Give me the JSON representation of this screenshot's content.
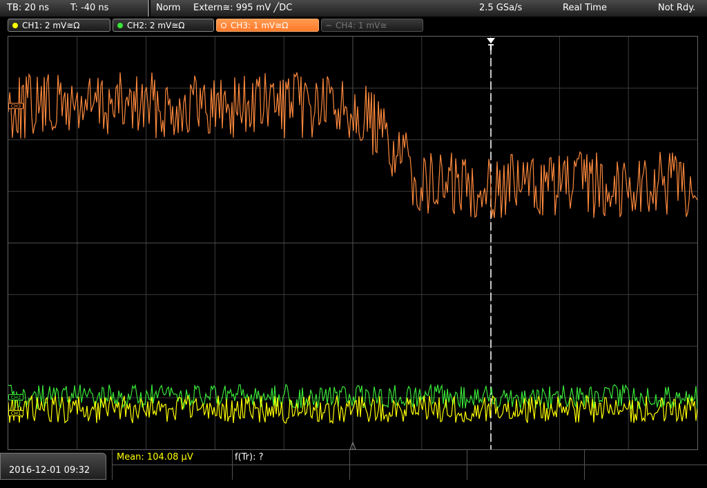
{
  "header": {
    "timebase": "TB: 20 ns",
    "trigger_time": "T: -40 ns",
    "acq_mode": "Norm",
    "trigger_source": "Extern≅: 995 mV ╱DC",
    "sample_rate": "2.5 GSa/s",
    "mode": "Real Time",
    "status": "Not Rdy."
  },
  "channels": [
    {
      "label": "CH1: 2 mV≅Ω",
      "color": "#ffff00",
      "state": "on"
    },
    {
      "label": "CH2: 2 mV≅Ω",
      "color": "#39e639",
      "state": "on"
    },
    {
      "label": "CH3: 1 mV≅Ω",
      "color": "#ff8a3d",
      "state": "active"
    },
    {
      "label": "CH4: 1 mV≅",
      "color": "#777777",
      "state": "off"
    }
  ],
  "markers": {
    "ch3": "CH3",
    "ch2": "CH2",
    "ch1": "CH1"
  },
  "trigger_marker": "T",
  "footer": {
    "datetime": "2016-12-01 09:32",
    "mean": "Mean: 104.08 µV",
    "rise_time": "f(Tr): ?"
  },
  "colors": {
    "ch1": "#ffff00",
    "ch2": "#39e639",
    "ch3": "#ff8a3d",
    "grid": "#3c3c3c"
  }
}
